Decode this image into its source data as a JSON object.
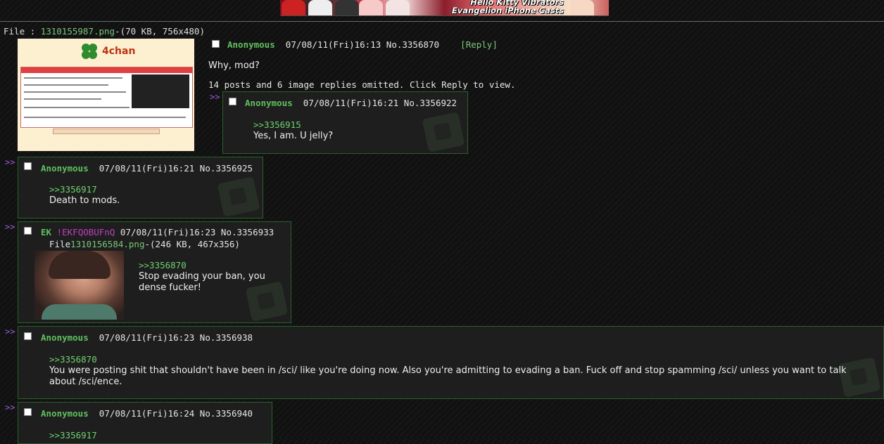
{
  "banner": {
    "line1": "Hello Kitty Vibrators",
    "line2": "Evangelion iPhone Casts"
  },
  "op": {
    "file_label": "File : ",
    "file_name": "1310155987.png",
    "file_info": "-(70 KB, 756x480)",
    "thumb_logo": "4chan",
    "name": "Anonymous",
    "datetime": "07/08/11(Fri)16:13",
    "post_no": "No.3356870",
    "reply_label": "[Reply]",
    "body": "Why, mod?",
    "omitted": "14 posts and 6 image replies omitted. Click Reply to view."
  },
  "arrow": ">>",
  "replies": [
    {
      "name": "Anonymous",
      "datetime": "07/08/11(Fri)16:21",
      "post_no": "No.3356922",
      "quote": ">>3356915",
      "body": "Yes, I am. U jelly?"
    },
    {
      "name": "Anonymous",
      "datetime": "07/08/11(Fri)16:21",
      "post_no": "No.3356925",
      "quote": ">>3356917",
      "body": "Death to mods."
    },
    {
      "name": "EK",
      "trip": "!EKFQOBUFnQ",
      "datetime": "07/08/11(Fri)16:23",
      "post_no": "No.3356933",
      "file_label": "File",
      "file_name": "1310156584.png",
      "file_info": "-(246 KB, 467x356)",
      "quote": ">>3356870",
      "body_l1": "Stop evading your ban, you",
      "body_l2": "dense fucker!"
    },
    {
      "name": "Anonymous",
      "datetime": "07/08/11(Fri)16:23",
      "post_no": "No.3356938",
      "quote": ">>3356870",
      "body_l1": "You were posting shit that shouldn't have been in /sci/ like you're doing now. Also you're admitting to evading a ban. Fuck off and stop spamming /sci/ unless you want to talk",
      "body_l2": "about /sci/ence."
    },
    {
      "name": "Anonymous",
      "datetime": "07/08/11(Fri)16:24",
      "post_no": "No.3356940",
      "quote": ">>3356917"
    }
  ]
}
